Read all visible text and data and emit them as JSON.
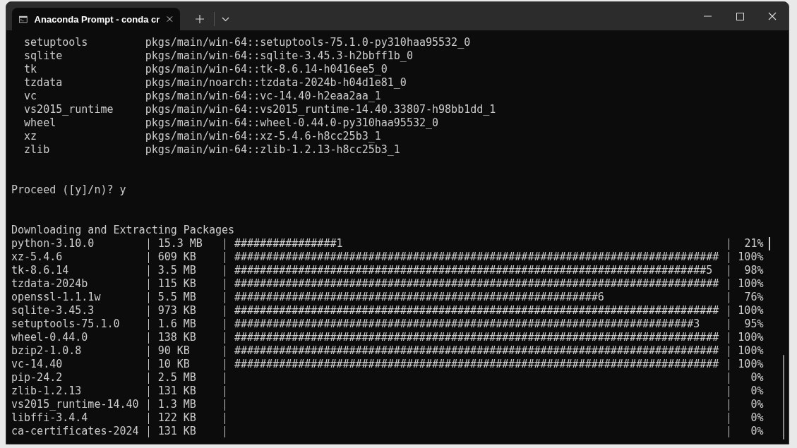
{
  "window": {
    "tab": {
      "title": "Anaconda Prompt - conda  cr"
    }
  },
  "terminal": {
    "packages": [
      {
        "name": "setuptools",
        "spec": "pkgs/main/win-64::setuptools-75.1.0-py310haa95532_0"
      },
      {
        "name": "sqlite",
        "spec": "pkgs/main/win-64::sqlite-3.45.3-h2bbff1b_0"
      },
      {
        "name": "tk",
        "spec": "pkgs/main/win-64::tk-8.6.14-h0416ee5_0"
      },
      {
        "name": "tzdata",
        "spec": "pkgs/main/noarch::tzdata-2024b-h04d1e81_0"
      },
      {
        "name": "vc",
        "spec": "pkgs/main/win-64::vc-14.40-h2eaa2aa_1"
      },
      {
        "name": "vs2015_runtime",
        "spec": "pkgs/main/win-64::vs2015_runtime-14.40.33807-h98bb1dd_1"
      },
      {
        "name": "wheel",
        "spec": "pkgs/main/win-64::wheel-0.44.0-py310haa95532_0"
      },
      {
        "name": "xz",
        "spec": "pkgs/main/win-64::xz-5.4.6-h8cc25b3_1"
      },
      {
        "name": "zlib",
        "spec": "pkgs/main/win-64::zlib-1.2.13-h8cc25b3_1"
      }
    ],
    "prompt": {
      "question": "Proceed ([y]/n)?",
      "answer": "y"
    },
    "heading": "Downloading and Extracting Packages",
    "downloads": [
      {
        "name": "python-3.10.0",
        "size": "15.3 MB",
        "bar": "################1",
        "percent": "21%",
        "cursor": true
      },
      {
        "name": "xz-5.4.6",
        "size": "609 KB",
        "bar": "############################################################################",
        "percent": "100%"
      },
      {
        "name": "tk-8.6.14",
        "size": "3.5 MB",
        "bar": "##########################################################################5",
        "percent": "98%"
      },
      {
        "name": "tzdata-2024b",
        "size": "115 KB",
        "bar": "############################################################################",
        "percent": "100%"
      },
      {
        "name": "openssl-1.1.1w",
        "size": "5.5 MB",
        "bar": "#########################################################6",
        "percent": "76%"
      },
      {
        "name": "sqlite-3.45.3",
        "size": "973 KB",
        "bar": "############################################################################",
        "percent": "100%"
      },
      {
        "name": "setuptools-75.1.0",
        "size": "1.6 MB",
        "bar": "########################################################################3",
        "percent": "95%"
      },
      {
        "name": "wheel-0.44.0",
        "size": "138 KB",
        "bar": "############################################################################",
        "percent": "100%"
      },
      {
        "name": "bzip2-1.0.8",
        "size": "90 KB",
        "bar": "############################################################################",
        "percent": "100%"
      },
      {
        "name": "vc-14.40",
        "size": "10 KB",
        "bar": "############################################################################",
        "percent": "100%"
      },
      {
        "name": "pip-24.2",
        "size": "2.5 MB",
        "percent": "0%"
      },
      {
        "name": "zlib-1.2.13",
        "size": "131 KB",
        "percent": "0%"
      },
      {
        "name": "vs2015_runtime-14.40",
        "size": "1.3 MB",
        "percent": "0%"
      },
      {
        "name": "libffi-3.4.4",
        "size": "122 KB",
        "percent": "0%"
      },
      {
        "name": "ca-certificates-2024",
        "size": "131 KB",
        "percent": "0%"
      }
    ]
  }
}
